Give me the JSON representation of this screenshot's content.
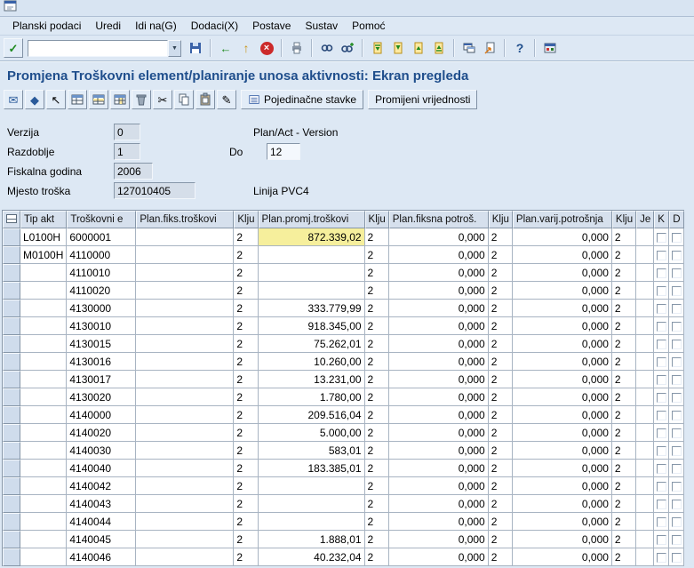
{
  "menu": {
    "items": [
      "Planski podaci",
      "Uredi",
      "Idi na(G)",
      "Dodaci(X)",
      "Postave",
      "Sustav",
      "Pomoć"
    ]
  },
  "toolbar": {
    "command_value": ""
  },
  "title": "Promjena Troškovni element/planiranje unosa aktivnosti: Ekran pregleda",
  "app_toolbar": {
    "line_items_label": "Pojedinačne stavke",
    "change_values_label": "Promijeni vrijednosti"
  },
  "form": {
    "verzija_label": "Verzija",
    "verzija_value": "0",
    "verzija_desc": "Plan/Act - Version",
    "razdoblje_label": "Razdoblje",
    "razdoblje_value": "1",
    "do_label": "Do",
    "do_value": "12",
    "fiskalna_label": "Fiskalna godina",
    "fiskalna_value": "2006",
    "mjesto_label": "Mjesto troška",
    "mjesto_value": "127010405",
    "mjesto_desc": "Linija PVC4"
  },
  "table": {
    "headers": [
      "Tip akt",
      "Troškovni e",
      "Plan.fiks.troškovi",
      "Klju",
      "Plan.promj.troškovi",
      "Klju",
      "Plan.fiksna potroš.",
      "Klju",
      "Plan.varij.potrošnja",
      "Klju",
      "Je",
      "K",
      "D"
    ],
    "rows": [
      {
        "tip": "L0100H",
        "elem": "6000001",
        "fiks": "",
        "k1": "2",
        "promj": "872.339,02",
        "k2": "2",
        "fpotr": "0,000",
        "k3": "2",
        "vpotr": "0,000",
        "k4": "2",
        "je": "",
        "highlight": true
      },
      {
        "tip": "M0100H",
        "elem": "4110000",
        "fiks": "",
        "k1": "2",
        "promj": "",
        "k2": "2",
        "fpotr": "0,000",
        "k3": "2",
        "vpotr": "0,000",
        "k4": "2",
        "je": ""
      },
      {
        "tip": "",
        "elem": "4110010",
        "fiks": "",
        "k1": "2",
        "promj": "",
        "k2": "2",
        "fpotr": "0,000",
        "k3": "2",
        "vpotr": "0,000",
        "k4": "2",
        "je": ""
      },
      {
        "tip": "",
        "elem": "4110020",
        "fiks": "",
        "k1": "2",
        "promj": "",
        "k2": "2",
        "fpotr": "0,000",
        "k3": "2",
        "vpotr": "0,000",
        "k4": "2",
        "je": ""
      },
      {
        "tip": "",
        "elem": "4130000",
        "fiks": "",
        "k1": "2",
        "promj": "333.779,99",
        "k2": "2",
        "fpotr": "0,000",
        "k3": "2",
        "vpotr": "0,000",
        "k4": "2",
        "je": ""
      },
      {
        "tip": "",
        "elem": "4130010",
        "fiks": "",
        "k1": "2",
        "promj": "918.345,00",
        "k2": "2",
        "fpotr": "0,000",
        "k3": "2",
        "vpotr": "0,000",
        "k4": "2",
        "je": ""
      },
      {
        "tip": "",
        "elem": "4130015",
        "fiks": "",
        "k1": "2",
        "promj": "75.262,01",
        "k2": "2",
        "fpotr": "0,000",
        "k3": "2",
        "vpotr": "0,000",
        "k4": "2",
        "je": ""
      },
      {
        "tip": "",
        "elem": "4130016",
        "fiks": "",
        "k1": "2",
        "promj": "10.260,00",
        "k2": "2",
        "fpotr": "0,000",
        "k3": "2",
        "vpotr": "0,000",
        "k4": "2",
        "je": ""
      },
      {
        "tip": "",
        "elem": "4130017",
        "fiks": "",
        "k1": "2",
        "promj": "13.231,00",
        "k2": "2",
        "fpotr": "0,000",
        "k3": "2",
        "vpotr": "0,000",
        "k4": "2",
        "je": ""
      },
      {
        "tip": "",
        "elem": "4130020",
        "fiks": "",
        "k1": "2",
        "promj": "1.780,00",
        "k2": "2",
        "fpotr": "0,000",
        "k3": "2",
        "vpotr": "0,000",
        "k4": "2",
        "je": ""
      },
      {
        "tip": "",
        "elem": "4140000",
        "fiks": "",
        "k1": "2",
        "promj": "209.516,04",
        "k2": "2",
        "fpotr": "0,000",
        "k3": "2",
        "vpotr": "0,000",
        "k4": "2",
        "je": ""
      },
      {
        "tip": "",
        "elem": "4140020",
        "fiks": "",
        "k1": "2",
        "promj": "5.000,00",
        "k2": "2",
        "fpotr": "0,000",
        "k3": "2",
        "vpotr": "0,000",
        "k4": "2",
        "je": ""
      },
      {
        "tip": "",
        "elem": "4140030",
        "fiks": "",
        "k1": "2",
        "promj": "583,01",
        "k2": "2",
        "fpotr": "0,000",
        "k3": "2",
        "vpotr": "0,000",
        "k4": "2",
        "je": ""
      },
      {
        "tip": "",
        "elem": "4140040",
        "fiks": "",
        "k1": "2",
        "promj": "183.385,01",
        "k2": "2",
        "fpotr": "0,000",
        "k3": "2",
        "vpotr": "0,000",
        "k4": "2",
        "je": ""
      },
      {
        "tip": "",
        "elem": "4140042",
        "fiks": "",
        "k1": "2",
        "promj": "",
        "k2": "2",
        "fpotr": "0,000",
        "k3": "2",
        "vpotr": "0,000",
        "k4": "2",
        "je": ""
      },
      {
        "tip": "",
        "elem": "4140043",
        "fiks": "",
        "k1": "2",
        "promj": "",
        "k2": "2",
        "fpotr": "0,000",
        "k3": "2",
        "vpotr": "0,000",
        "k4": "2",
        "je": ""
      },
      {
        "tip": "",
        "elem": "4140044",
        "fiks": "",
        "k1": "2",
        "promj": "",
        "k2": "2",
        "fpotr": "0,000",
        "k3": "2",
        "vpotr": "0,000",
        "k4": "2",
        "je": ""
      },
      {
        "tip": "",
        "elem": "4140045",
        "fiks": "",
        "k1": "2",
        "promj": "1.888,01",
        "k2": "2",
        "fpotr": "0,000",
        "k3": "2",
        "vpotr": "0,000",
        "k4": "2",
        "je": ""
      },
      {
        "tip": "",
        "elem": "4140046",
        "fiks": "",
        "k1": "2",
        "promj": "40.232,04",
        "k2": "2",
        "fpotr": "0,000",
        "k3": "2",
        "vpotr": "0,000",
        "k4": "2",
        "je": ""
      }
    ]
  },
  "icons": {
    "enter": "✓",
    "dropdown": "▼",
    "back": "←",
    "exit": "↑",
    "cancel": "×",
    "help": "?",
    "mail": "✉",
    "gem": "◆",
    "select": "↖",
    "cut": "✂",
    "edit": "✎"
  },
  "colors": {
    "accent": "#1f4e8c",
    "highlight": "#f6ef9c"
  }
}
